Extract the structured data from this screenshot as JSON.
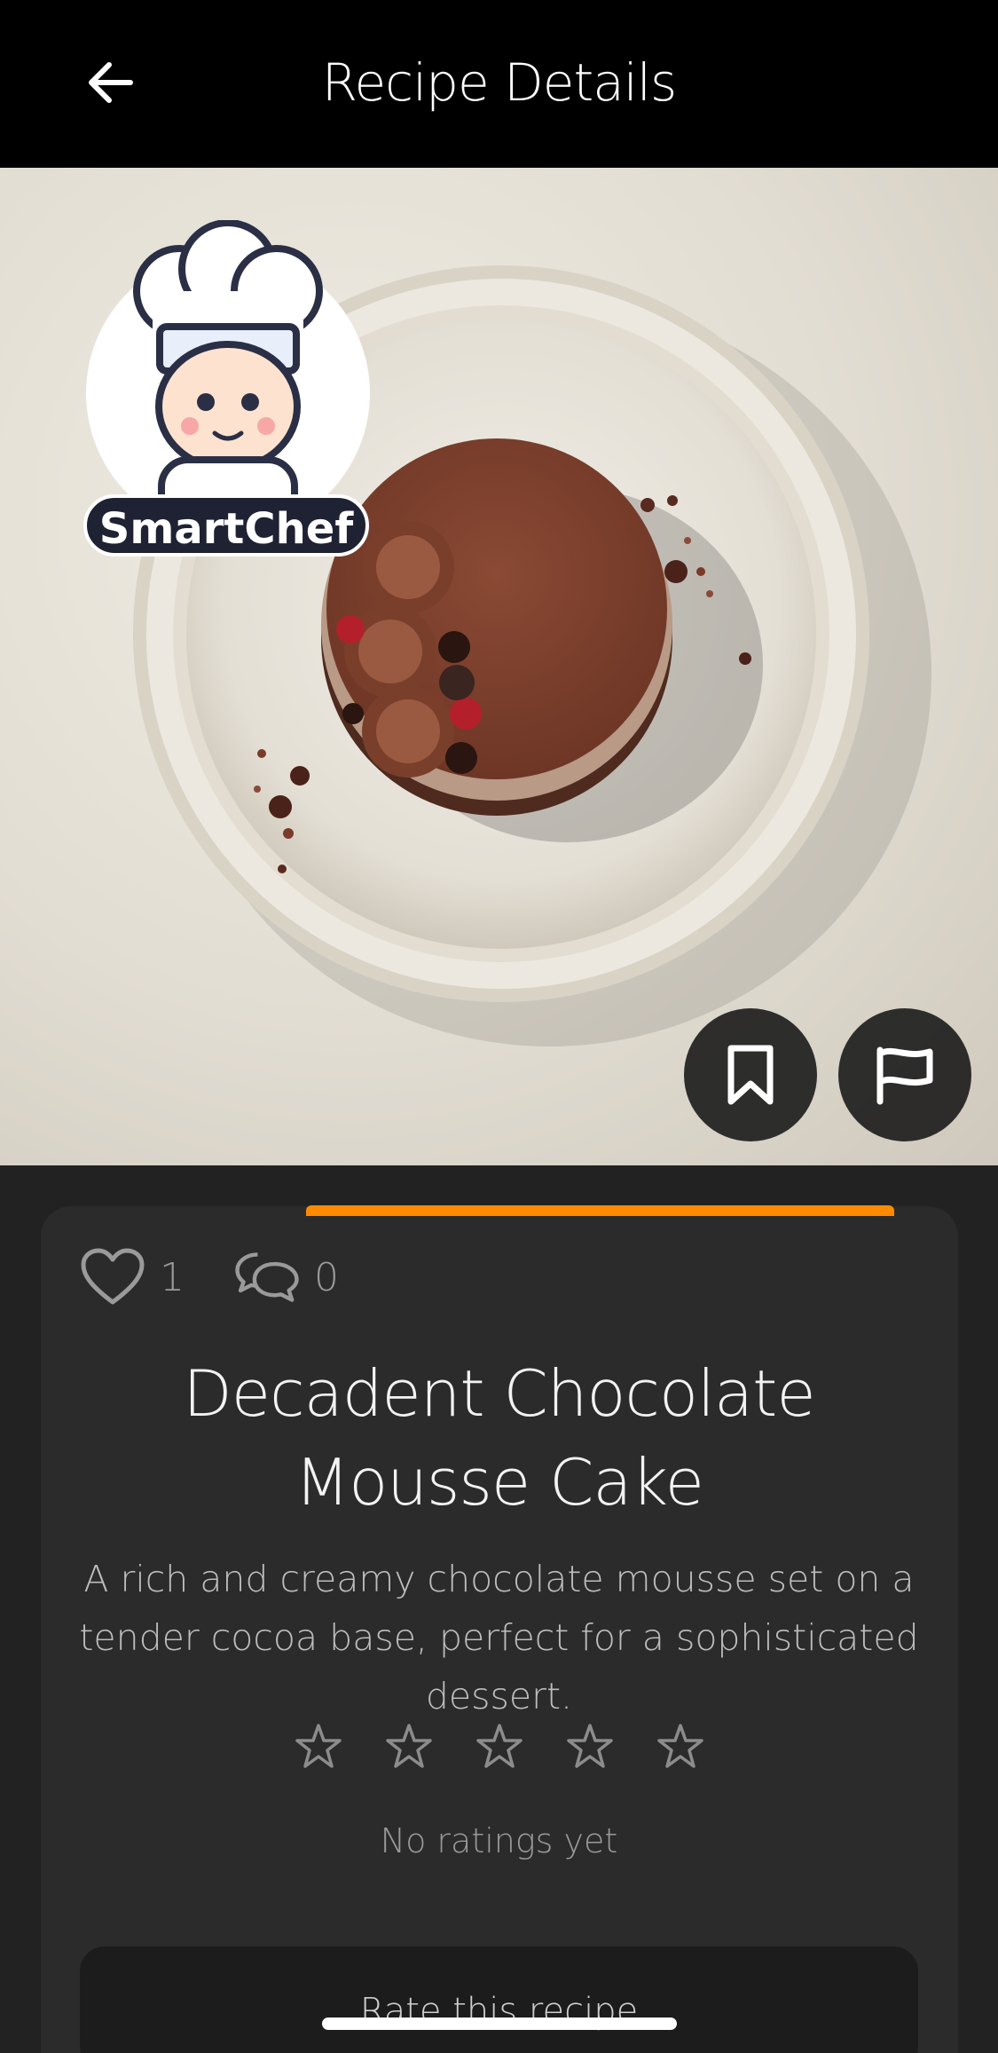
{
  "header": {
    "title": "Recipe Details",
    "back_icon": "arrow-left-icon"
  },
  "hero": {
    "image_subject": "chocolate mousse cake on white plate",
    "logo_text": "SmartChef",
    "save_icon": "bookmark-icon",
    "report_icon": "flag-icon"
  },
  "stats": {
    "likes": "1",
    "comments": "0",
    "like_icon": "heart-icon",
    "comment_icon": "chat-bubbles-icon"
  },
  "recipe": {
    "title": "Decadent Chocolate Mousse Cake",
    "description": "A rich and creamy chocolate mousse set on a tender cocoa base, perfect for a sophisticated dessert."
  },
  "rating": {
    "stars_filled": 0,
    "stars_total": 5,
    "status": "No ratings yet",
    "rate_button": "Rate this recipe"
  },
  "colors": {
    "accent": "#ff8a00",
    "background": "#222222",
    "card": "#2b2b2b",
    "header": "#000000"
  }
}
